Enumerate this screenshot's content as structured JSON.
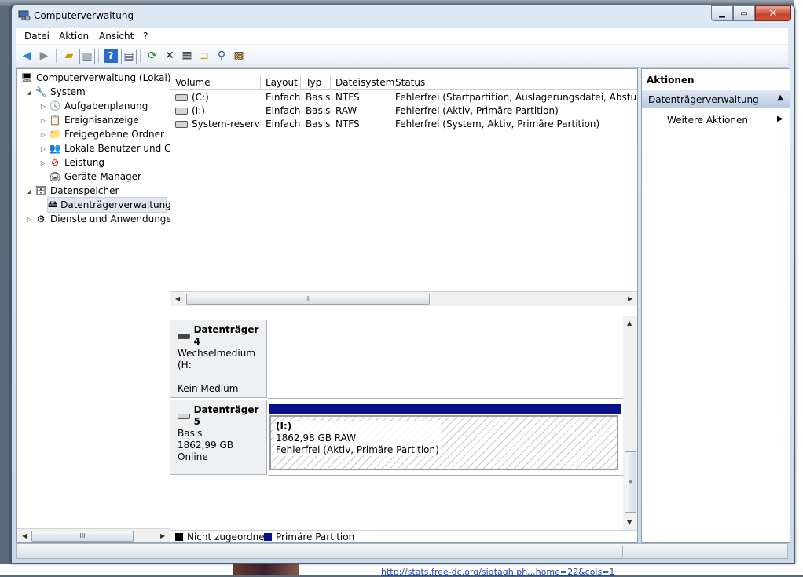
{
  "window": {
    "title": "Computerverwaltung"
  },
  "menu": [
    "Datei",
    "Aktion",
    "Ansicht",
    "?"
  ],
  "toolbar": {
    "buttons": [
      "back-arrow-icon",
      "forward-arrow-icon",
      "up-folder-icon",
      "show-hide-tree-icon",
      "help-icon",
      "show-hide-action-pane-icon",
      "refresh-icon",
      "delete-icon",
      "properties-icon",
      "open-folder-icon",
      "search-icon",
      "export-icon"
    ]
  },
  "tree": {
    "root": "Computerverwaltung (Lokal)",
    "system": "System",
    "system_items": [
      "Aufgabenplanung",
      "Ereignisanzeige",
      "Freigegebene Ordner",
      "Lokale Benutzer und Gruppen",
      "Leistung",
      "Geräte-Manager"
    ],
    "storage": "Datenspeicher",
    "storage_items": [
      "Datenträgerverwaltung"
    ],
    "services": "Dienste und Anwendungen"
  },
  "volumes": {
    "columns": [
      "Volume",
      "Layout",
      "Typ",
      "Dateisystem",
      "Status"
    ],
    "rows": [
      [
        "(C:)",
        "Einfach",
        "Basis",
        "NTFS",
        "Fehlerfrei (Startpartition, Auslagerungsdatei, Absturzabbild"
      ],
      [
        "(I:)",
        "Einfach",
        "Basis",
        "RAW",
        "Fehlerfrei (Aktiv, Primäre Partition)"
      ],
      [
        "System-reserviert",
        "Einfach",
        "Basis",
        "NTFS",
        "Fehlerfrei (System, Aktiv, Primäre Partition)"
      ]
    ]
  },
  "disks": [
    {
      "name": "Datenträger 4",
      "type": "Wechselmedium (H:",
      "state": "Kein Medium"
    },
    {
      "name": "Datenträger 5",
      "type": "Basis",
      "size": "1862,99 GB",
      "state": "Online",
      "partition": {
        "label": "(I:)",
        "size": "1862,98 GB RAW",
        "status": "Fehlerfrei (Aktiv, Primäre Partition)"
      }
    }
  ],
  "legend": [
    {
      "label": "Nicht zugeordnet",
      "color": "#000000"
    },
    {
      "label": "Primäre Partition",
      "color": "#0a0f8a"
    }
  ],
  "actions": {
    "header": "Aktionen",
    "section": "Datenträgerverwaltung",
    "more": "Weitere Aktionen"
  },
  "background": {
    "link": "http://stats.free-dc.org/sigtagh.ph...home=22&cols=1"
  }
}
